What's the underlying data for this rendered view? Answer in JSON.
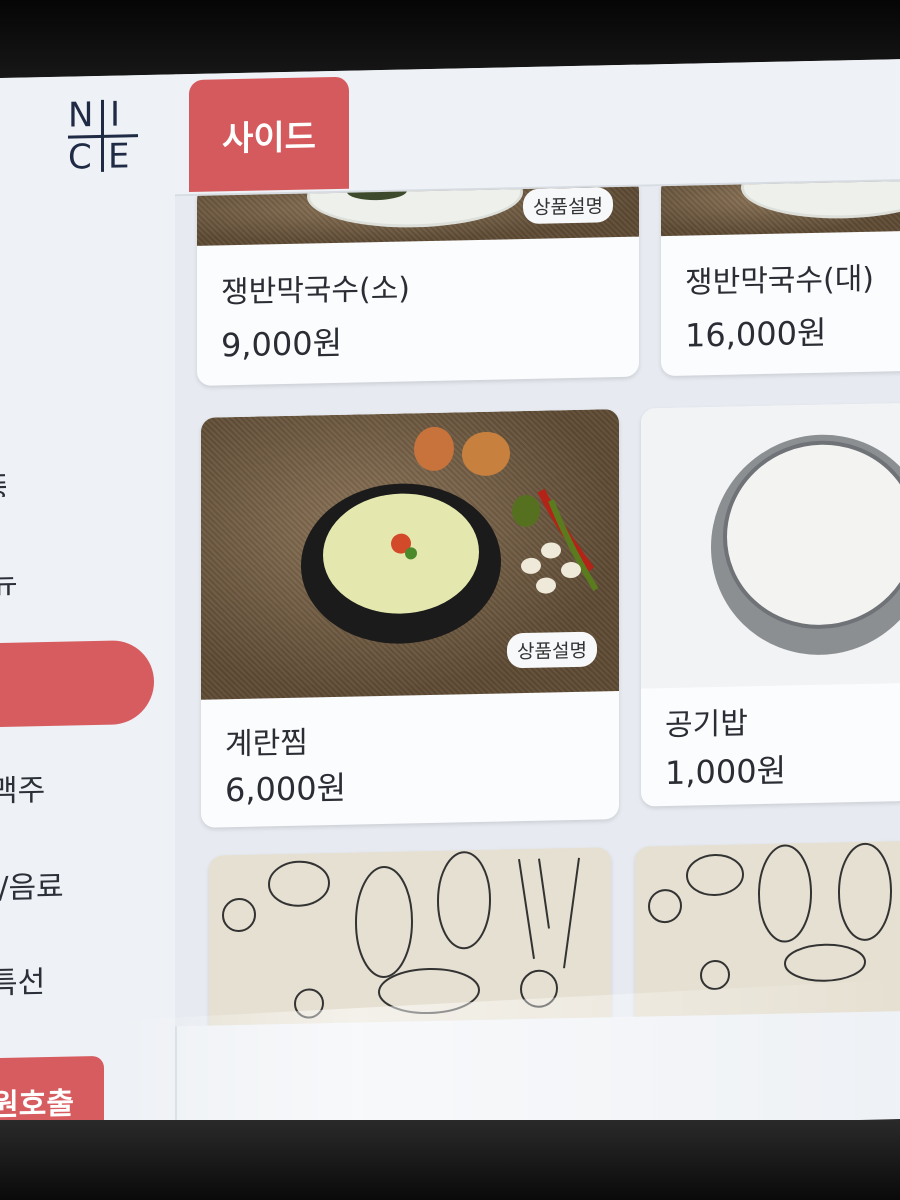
{
  "brand": {
    "logo_letters": [
      "N",
      "I",
      "C",
      "E"
    ]
  },
  "sidebar": {
    "items": [
      {
        "label": "뉴"
      },
      {
        "label": "맥주"
      },
      {
        "label": "l/음료"
      },
      {
        "label": "특선"
      }
    ],
    "call_button": "원호출"
  },
  "category": {
    "active_tab": "사이드"
  },
  "menu": {
    "badge_label": "상품설명",
    "items": [
      {
        "name": "쟁반막국수(소)",
        "price": "9,000원"
      },
      {
        "name": "쟁반막국수(대)",
        "price": "16,000원"
      },
      {
        "name": "계란찜",
        "price": "6,000원"
      },
      {
        "name": "공기밥",
        "price": "1,000원"
      }
    ]
  },
  "colors": {
    "accent": "#d65c5f",
    "text": "#2a2d33",
    "background": "#eef1f5"
  }
}
